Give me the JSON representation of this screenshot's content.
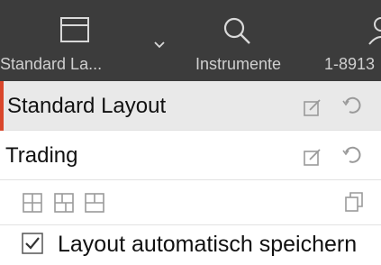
{
  "toolbar": {
    "items": [
      {
        "label": "Standard La...",
        "icon": "layout-window-icon",
        "has_dropdown": true
      },
      {
        "label": "Instrumente",
        "icon": "search-icon"
      },
      {
        "label": "1-8913",
        "icon": "user-icon"
      }
    ]
  },
  "layouts": [
    {
      "label": "Standard Layout",
      "selected": true
    },
    {
      "label": "Trading",
      "selected": false
    }
  ],
  "layout_tools": {
    "icons": [
      "grid-four-icon",
      "grid-split-icon",
      "grid-two-icon"
    ],
    "copy_icon": "copy-icon"
  },
  "autosave": {
    "label": "Layout automatisch speichern",
    "checked": true
  },
  "colors": {
    "toolbar_bg": "#3c3c3c",
    "selected_bg": "#e9e9e9",
    "accent": "#d9462b",
    "icon_gray": "#9a9a9a"
  }
}
